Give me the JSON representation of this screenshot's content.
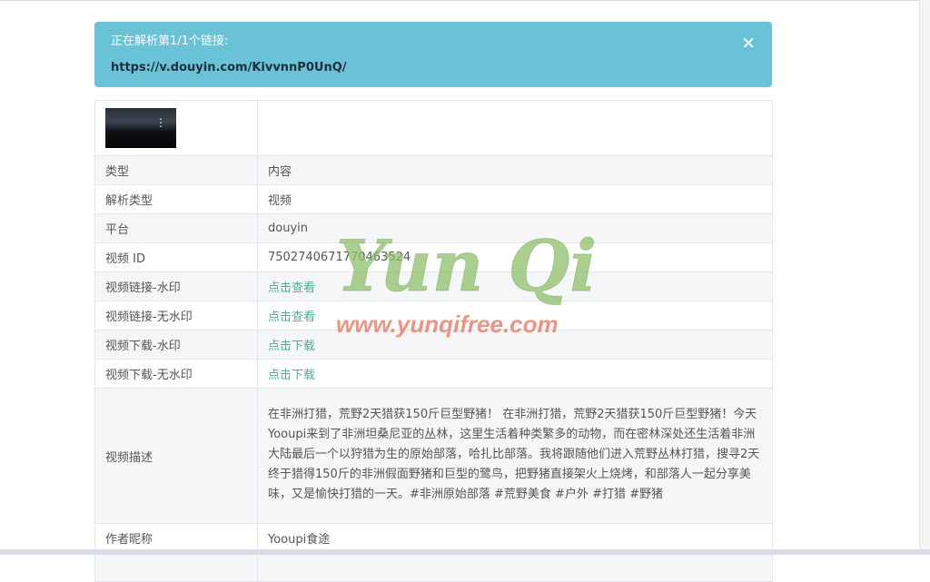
{
  "alert": {
    "title": "正在解析第1/1个链接:",
    "url": "https://v.douyin.com/KivvnnP0UnQ/",
    "close_glyph": "×"
  },
  "table": {
    "header": {
      "key": "类型",
      "value": "内容"
    },
    "rows": [
      {
        "key": "解析类型",
        "value": "视频"
      },
      {
        "key": "平台",
        "value": "douyin"
      },
      {
        "key": "视频 ID",
        "value": "7502740671770463524"
      },
      {
        "key": "视频链接-水印",
        "value": "点击查看"
      },
      {
        "key": "视频链接-无水印",
        "value": "点击查看"
      },
      {
        "key": "视频下载-水印",
        "value": "点击下载"
      },
      {
        "key": "视频下载-无水印",
        "value": "点击下载"
      },
      {
        "key": "视频描述",
        "value": "在非洲打猎，荒野2天猎获150斤巨型野猪！ 在非洲打猎，荒野2天猎获150斤巨型野猪！今天Yooupi来到了非洲坦桑尼亚的丛林，这里生活着种类繁多的动物，而在密林深处还生活着非洲大陆最后一个以狩猎为生的原始部落，哈扎比部落。我将跟随他们进入荒野丛林打猎，搜寻2天终于猎得150斤的非洲假面野猪和巨型的鹭鸟，把野猪直接架火上烧烤，和部落人一起分享美味，又是愉快打猎的一天。#非洲原始部落 #荒野美食 #户外 #打猎 #野猪"
      },
      {
        "key": "作者昵称",
        "value": "Yooupi食途"
      }
    ]
  },
  "watermark": {
    "script_text": "Yun Qi",
    "url_text": "www.yunqifree.com"
  },
  "thumbnail": {
    "menu_glyph": "⋮"
  }
}
